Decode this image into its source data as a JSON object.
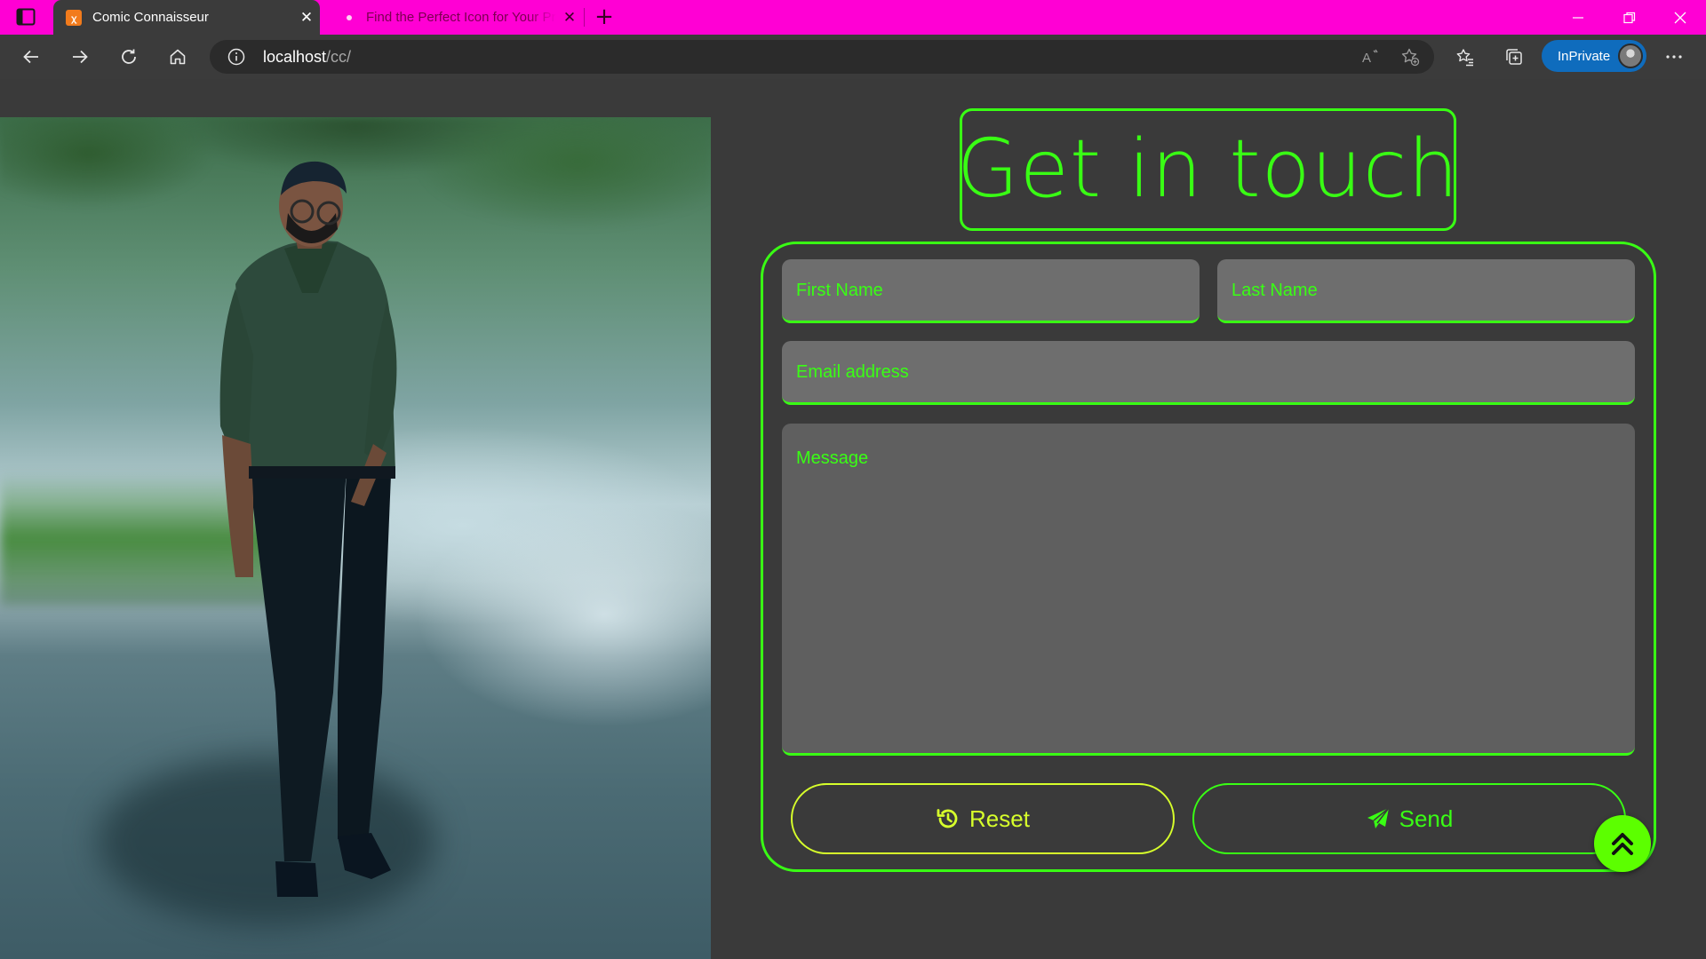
{
  "browser": {
    "tabs": [
      {
        "title": "Comic Connaisseur",
        "active": true
      },
      {
        "title": "Find the Perfect Icon for Your Pro",
        "active": false
      }
    ],
    "address": {
      "host": "localhost",
      "path": "/cc/"
    },
    "inprivate_label": "InPrivate"
  },
  "page": {
    "heading": "Get in touch",
    "form": {
      "first_name_placeholder": "First Name",
      "last_name_placeholder": "Last Name",
      "email_placeholder": "Email address",
      "message_placeholder": "Message",
      "reset_label": "Reset",
      "send_label": "Send"
    }
  },
  "colors": {
    "accent_green": "#39ff14",
    "reset_yellow": "#d7ff2b",
    "titlebar_magenta": "#ff00d4",
    "page_background": "#3a3a3a",
    "field_background": "#6e6e6e"
  },
  "icons": {
    "reset": "history-icon",
    "send": "paper-plane-icon",
    "scroll_top": "double-chevron-up-icon"
  }
}
